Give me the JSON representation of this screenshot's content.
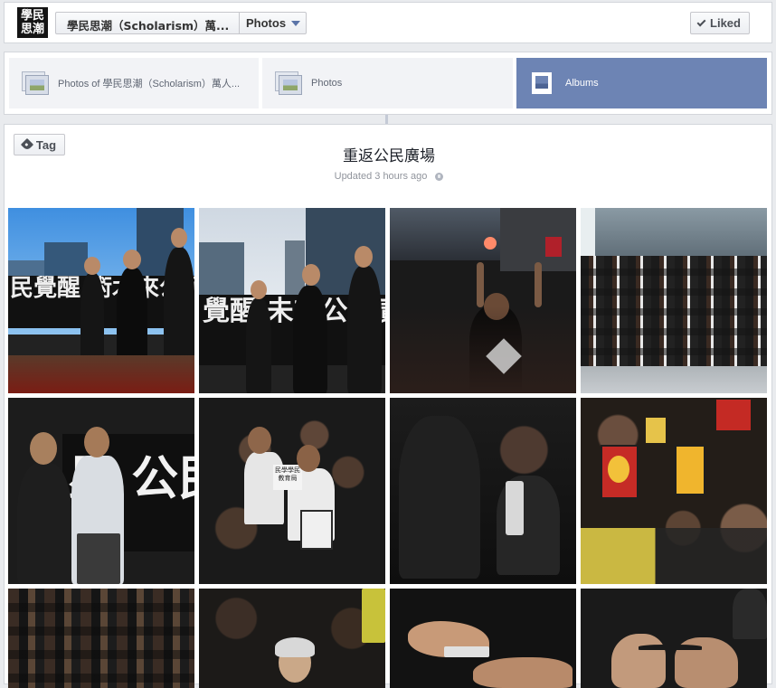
{
  "header": {
    "logo_lines": [
      "學民",
      "思潮"
    ],
    "page_name": "學民思潮（Scholarism）萬...",
    "photos_label": "Photos",
    "liked_label": "Liked"
  },
  "tabs": [
    {
      "label": "Photos of 學民思潮（Scholarism）萬人...",
      "active": false
    },
    {
      "label": "Photos",
      "active": false
    },
    {
      "label": "Albums",
      "active": true
    }
  ],
  "album": {
    "tag_label": "Tag",
    "title": "重返公民廣場",
    "updated": "Updated 3 hours ago",
    "photos": [
      {
        "name": "speakers-on-stage-daylight",
        "banner": "民覺醒 術木來公民廣"
      },
      {
        "name": "two-speakers-banner",
        "banner": "覺醒 未來公民廣"
      },
      {
        "name": "raised-hands-night"
      },
      {
        "name": "seated-crowd-night"
      },
      {
        "name": "speakers-with-microphones",
        "banner": "星 公民廣"
      },
      {
        "name": "students-seated-with-placard",
        "placard": "民學學民 教育局"
      },
      {
        "name": "students-in-dark"
      },
      {
        "name": "crowd-holding-signs"
      },
      {
        "name": "crowd-with-raised-hands"
      },
      {
        "name": "elderly-woman-in-crowd"
      },
      {
        "name": "hands-close-up"
      },
      {
        "name": "hands-tying-ribbon"
      }
    ]
  },
  "colors": {
    "accent": "#6d84b4",
    "page_bg": "#e9ebee",
    "card_border": "#d3d6db"
  }
}
